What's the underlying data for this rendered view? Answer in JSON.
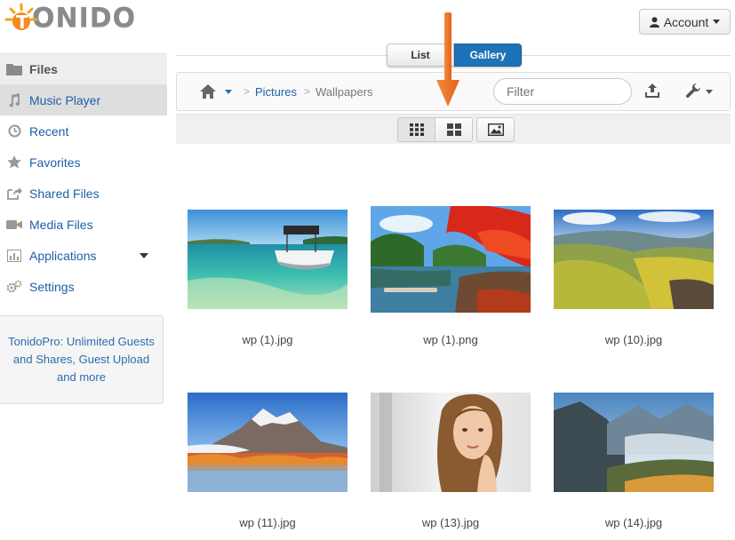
{
  "app": {
    "logo_text": "ONIDO"
  },
  "account": {
    "label": "Account"
  },
  "sidebar": {
    "items": [
      {
        "label": "Files",
        "icon": "folder-icon"
      },
      {
        "label": "Music Player",
        "icon": "music-icon"
      },
      {
        "label": "Recent",
        "icon": "clock-icon"
      },
      {
        "label": "Favorites",
        "icon": "star-icon"
      },
      {
        "label": "Shared Files",
        "icon": "share-icon"
      },
      {
        "label": "Media Files",
        "icon": "video-camera-icon"
      },
      {
        "label": "Applications",
        "icon": "bar-chart-icon"
      },
      {
        "label": "Settings",
        "icon": "gears-icon"
      }
    ],
    "promo": "TonidoPro: Unlimited Guests and Shares, Guest Upload and more"
  },
  "view_toggle": {
    "list": "List",
    "gallery": "Gallery",
    "active": "Gallery"
  },
  "breadcrumb": {
    "items": [
      {
        "label": "Pictures",
        "link": true
      },
      {
        "label": "Wallpapers",
        "link": false
      }
    ]
  },
  "filter": {
    "placeholder": "Filter"
  },
  "gallery": {
    "files": [
      {
        "name": "wp (1).jpg"
      },
      {
        "name": "wp (1).png"
      },
      {
        "name": "wp (10).jpg"
      },
      {
        "name": "wp (11).jpg"
      },
      {
        "name": "wp (13).jpg"
      },
      {
        "name": "wp (14).jpg"
      }
    ]
  },
  "colors": {
    "accent": "#1e72b8",
    "link": "#1f5fa8",
    "annotation_arrow": "#f07a2a"
  }
}
